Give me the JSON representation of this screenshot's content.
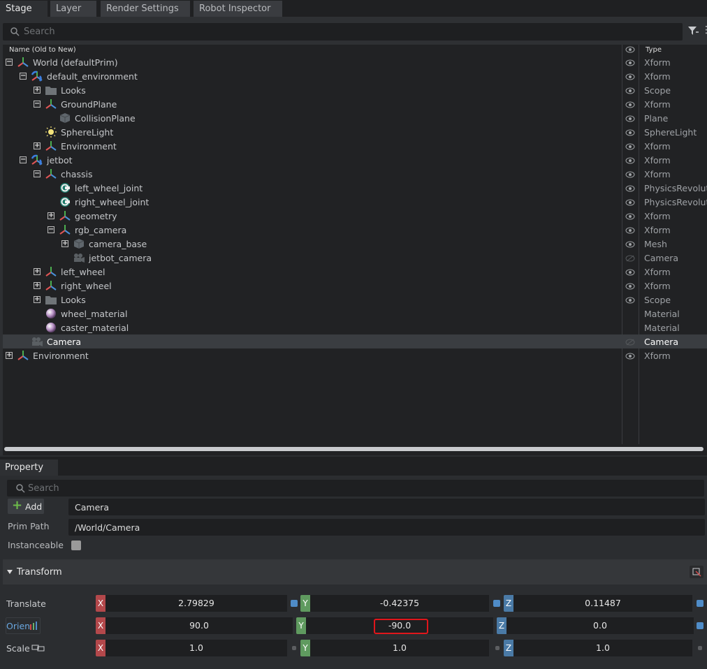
{
  "tabs": [
    "Stage",
    "Layer",
    "Render Settings",
    "Robot Inspector"
  ],
  "stage": {
    "search_placeholder": "Search",
    "col_name": "Name (Old to New)",
    "col_type": "Type",
    "rows": [
      {
        "label": "World (defaultPrim)",
        "type": "Xform",
        "exp": "−",
        "icon": "xform-icon",
        "eye": "visible"
      },
      {
        "label": "default_environment",
        "type": "Xform",
        "exp": "−",
        "icon": "xform-ref-icon",
        "eye": "visible"
      },
      {
        "label": "Looks",
        "type": "Scope",
        "exp": "+",
        "icon": "folder-icon",
        "eye": "visible"
      },
      {
        "label": "GroundPlane",
        "type": "Xform",
        "exp": "−",
        "icon": "xform-icon",
        "eye": "visible"
      },
      {
        "label": "CollisionPlane",
        "type": "Plane",
        "exp": "",
        "icon": "mesh-icon",
        "eye": "visible"
      },
      {
        "label": "SphereLight",
        "type": "SphereLight",
        "exp": "",
        "icon": "light-icon",
        "eye": "visible"
      },
      {
        "label": "Environment",
        "type": "Xform",
        "exp": "+",
        "icon": "xform-icon",
        "eye": "visible"
      },
      {
        "label": "jetbot",
        "type": "Xform",
        "exp": "−",
        "icon": "xform-ref-icon",
        "eye": "visible"
      },
      {
        "label": "chassis",
        "type": "Xform",
        "exp": "−",
        "icon": "xform-icon",
        "eye": "visible"
      },
      {
        "label": "left_wheel_joint",
        "type": "PhysicsRevoluteJoint",
        "exp": "",
        "icon": "joint-icon",
        "eye": "visible"
      },
      {
        "label": "right_wheel_joint",
        "type": "PhysicsRevoluteJoint",
        "exp": "",
        "icon": "joint-icon",
        "eye": "visible"
      },
      {
        "label": "geometry",
        "type": "Xform",
        "exp": "+",
        "icon": "xform-icon",
        "eye": "visible"
      },
      {
        "label": "rgb_camera",
        "type": "Xform",
        "exp": "−",
        "icon": "xform-icon",
        "eye": "visible"
      },
      {
        "label": "camera_base",
        "type": "Mesh",
        "exp": "+",
        "icon": "mesh-icon",
        "eye": "visible"
      },
      {
        "label": "jetbot_camera",
        "type": "Camera",
        "exp": "",
        "icon": "camera-icon",
        "eye": "hidden"
      },
      {
        "label": "left_wheel",
        "type": "Xform",
        "exp": "+",
        "icon": "xform-icon",
        "eye": "visible"
      },
      {
        "label": "right_wheel",
        "type": "Xform",
        "exp": "+",
        "icon": "xform-icon",
        "eye": "visible"
      },
      {
        "label": "Looks",
        "type": "Scope",
        "exp": "+",
        "icon": "folder-icon",
        "eye": "visible"
      },
      {
        "label": "wheel_material",
        "type": "Material",
        "exp": "",
        "icon": "material-icon",
        "eye": "none"
      },
      {
        "label": "caster_material",
        "type": "Material",
        "exp": "",
        "icon": "material-icon",
        "eye": "none"
      },
      {
        "label": "Camera",
        "type": "Camera",
        "exp": "",
        "icon": "camera-icon",
        "eye": "hidden",
        "selected": true
      },
      {
        "label": "Environment",
        "type": "Xform",
        "exp": "+",
        "icon": "xform-icon",
        "eye": "visible"
      }
    ]
  },
  "property": {
    "tab": "Property",
    "search_placeholder": "Search",
    "add_label": "Add",
    "prim_name": "Camera",
    "prim_path_label": "Prim Path",
    "prim_path": "/World/Camera",
    "instanceable_label": "Instanceable",
    "transform": {
      "title": "Transform",
      "translate_label": "Translate",
      "translate": {
        "x": "2.79829",
        "y": "-0.42375",
        "z": "0.11487"
      },
      "orient_label": "Orien",
      "orient": {
        "x": "90.0",
        "y": "-90.0",
        "z": "0.0"
      },
      "scale_label": "Scale",
      "scale": {
        "x": "1.0",
        "y": "1.0",
        "z": "1.0"
      },
      "axis": {
        "x": "X",
        "y": "Y",
        "z": "Z"
      }
    }
  }
}
